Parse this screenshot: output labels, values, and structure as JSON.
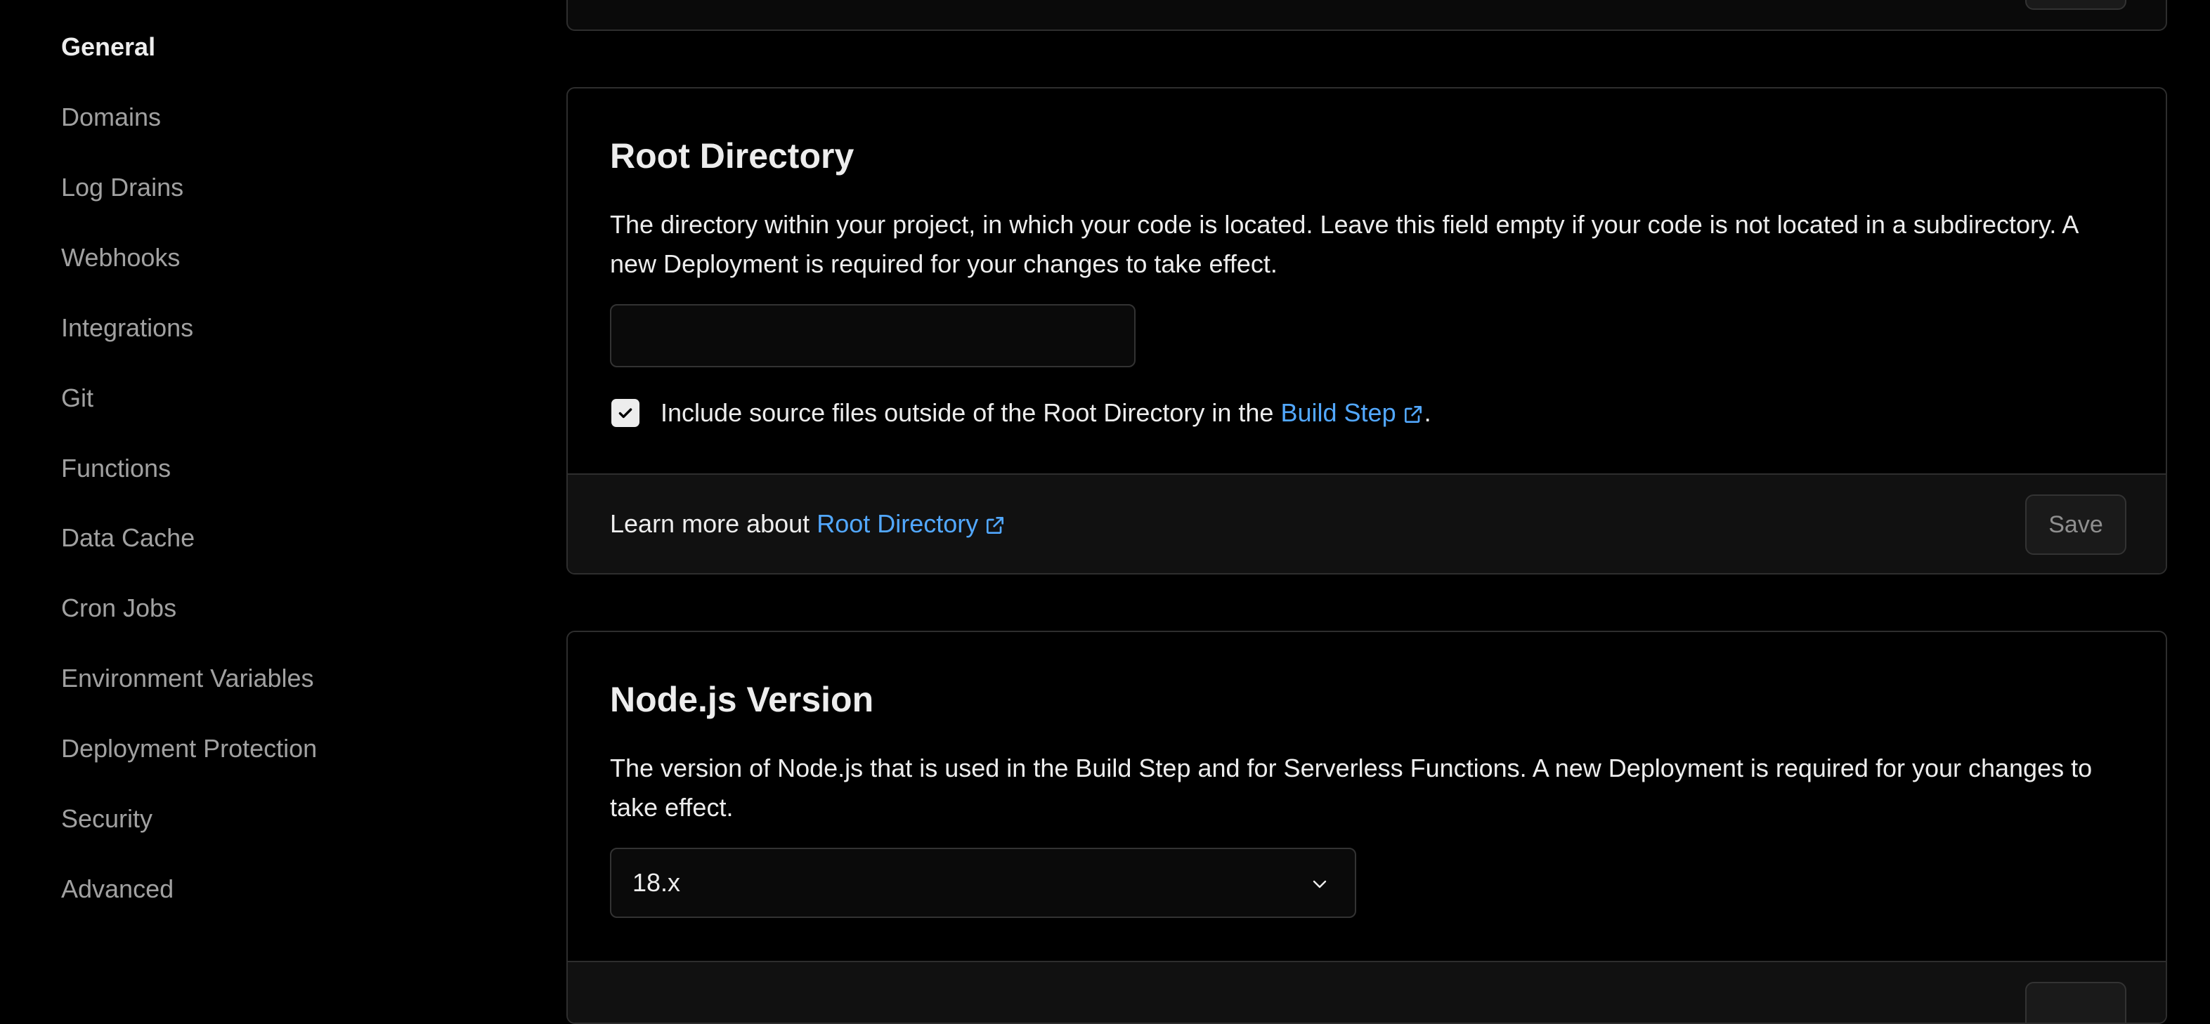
{
  "sidebar": {
    "items": [
      {
        "label": "General",
        "active": true
      },
      {
        "label": "Domains"
      },
      {
        "label": "Log Drains"
      },
      {
        "label": "Webhooks"
      },
      {
        "label": "Integrations"
      },
      {
        "label": "Git"
      },
      {
        "label": "Functions"
      },
      {
        "label": "Data Cache"
      },
      {
        "label": "Cron Jobs"
      },
      {
        "label": "Environment Variables"
      },
      {
        "label": "Deployment Protection"
      },
      {
        "label": "Security"
      },
      {
        "label": "Advanced"
      }
    ]
  },
  "root_directory": {
    "title": "Root Directory",
    "description": "The directory within your project, in which your code is located. Leave this field empty if your code is not located in a subdirectory. A new Deployment is required for your changes to take effect.",
    "input_value": "",
    "checkbox_checked": true,
    "checkbox_text": "Include source files outside of the Root Directory in the",
    "checkbox_link": "Build Step",
    "checkbox_suffix": ".",
    "footer_text": "Learn more about",
    "footer_link": "Root Directory",
    "save_label": "Save"
  },
  "node_version": {
    "title": "Node.js Version",
    "description": "The version of Node.js that is used in the Build Step and for Serverless Functions. A new Deployment is required for your changes to take effect.",
    "selected": "18.x"
  },
  "colors": {
    "background": "#000000",
    "card": "#0a0a0a",
    "border": "#2e2e2e",
    "link": "#52a8ff",
    "text": "#ededed",
    "muted": "#a1a1a1"
  },
  "icons": {
    "checkbox": "check-icon",
    "external_link": "external-link-icon",
    "select": "chevron-down-icon"
  }
}
